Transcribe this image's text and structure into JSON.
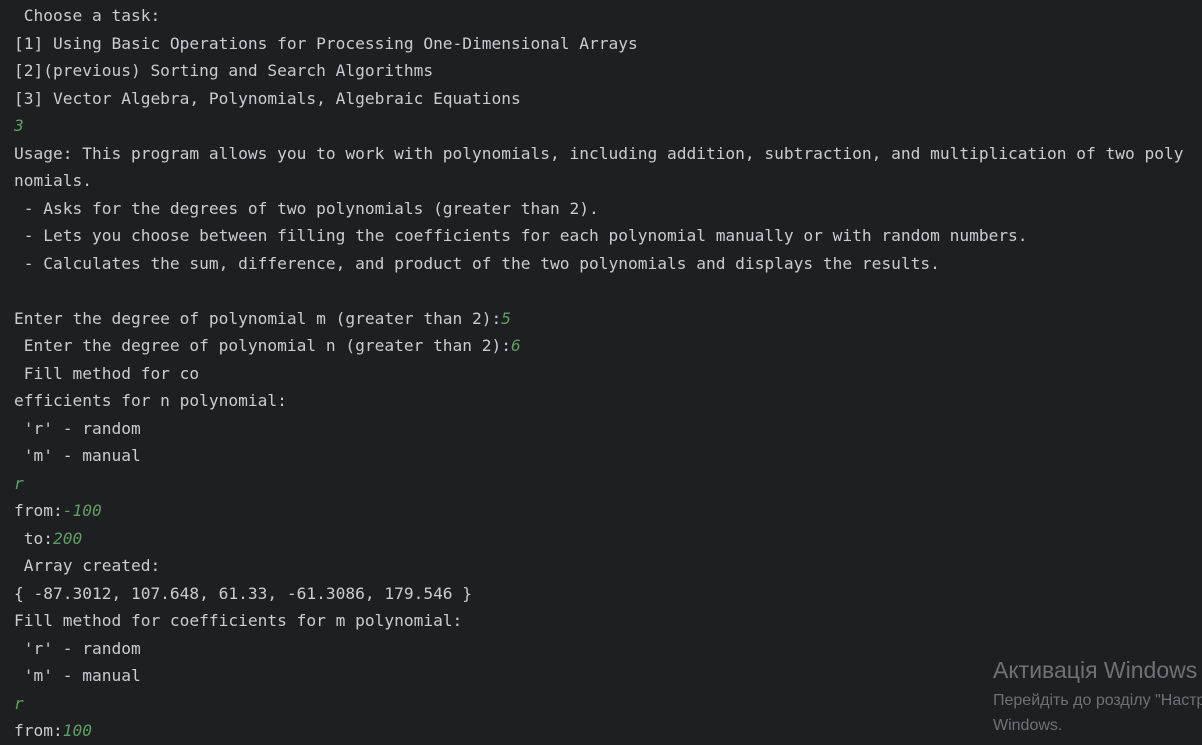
{
  "console": {
    "lines": [
      {
        "text": " Choose a task:",
        "input": ""
      },
      {
        "text": "[1] Using Basic Operations for Processing One-Dimensional Arrays",
        "input": ""
      },
      {
        "text": "[2](previous) Sorting and Search Algorithms",
        "input": ""
      },
      {
        "text": "[3] Vector Algebra, Polynomials, Algebraic Equations",
        "input": ""
      },
      {
        "text": "",
        "input": "3"
      },
      {
        "text": "Usage: This program allows you to work with polynomials, including addition, subtraction, and multiplication of two poly",
        "input": ""
      },
      {
        "text": "nomials.",
        "input": ""
      },
      {
        "text": " - Asks for the degrees of two polynomials (greater than 2).",
        "input": ""
      },
      {
        "text": " - Lets you choose between filling the coefficients for each polynomial manually or with random numbers.",
        "input": ""
      },
      {
        "text": " - Calculates the sum, difference, and product of the two polynomials and displays the results.",
        "input": ""
      },
      {
        "text": "",
        "input": ""
      },
      {
        "text": "Enter the degree of polynomial m (greater than 2):",
        "input": "5"
      },
      {
        "text": " Enter the degree of polynomial n (greater than 2):",
        "input": "6"
      },
      {
        "text": " Fill method for co",
        "input": ""
      },
      {
        "text": "efficients for n polynomial:",
        "input": ""
      },
      {
        "text": " 'r' - random",
        "input": ""
      },
      {
        "text": " 'm' - manual",
        "input": ""
      },
      {
        "text": "",
        "input": "r"
      },
      {
        "text": "from:",
        "input": "-100"
      },
      {
        "text": " to:",
        "input": "200"
      },
      {
        "text": " Array created:",
        "input": ""
      },
      {
        "text": "{ -87.3012, 107.648, 61.33, -61.3086, 179.546 }",
        "input": ""
      },
      {
        "text": "Fill method for coefficients for m polynomial:",
        "input": ""
      },
      {
        "text": " 'r' - random",
        "input": ""
      },
      {
        "text": " 'm' - manual",
        "input": ""
      },
      {
        "text": "",
        "input": "r"
      },
      {
        "text": "from:",
        "input": "100"
      }
    ]
  },
  "watermark": {
    "title": "Активація Windows",
    "line1": "Перейдіть до розділу \"Настройки\", щоб активувати",
    "line2": "Windows."
  },
  "colors": {
    "background": "#1e1f22",
    "output_text": "#c9ccd3",
    "user_input": "#5f9e62",
    "watermark": "#6e7178"
  }
}
